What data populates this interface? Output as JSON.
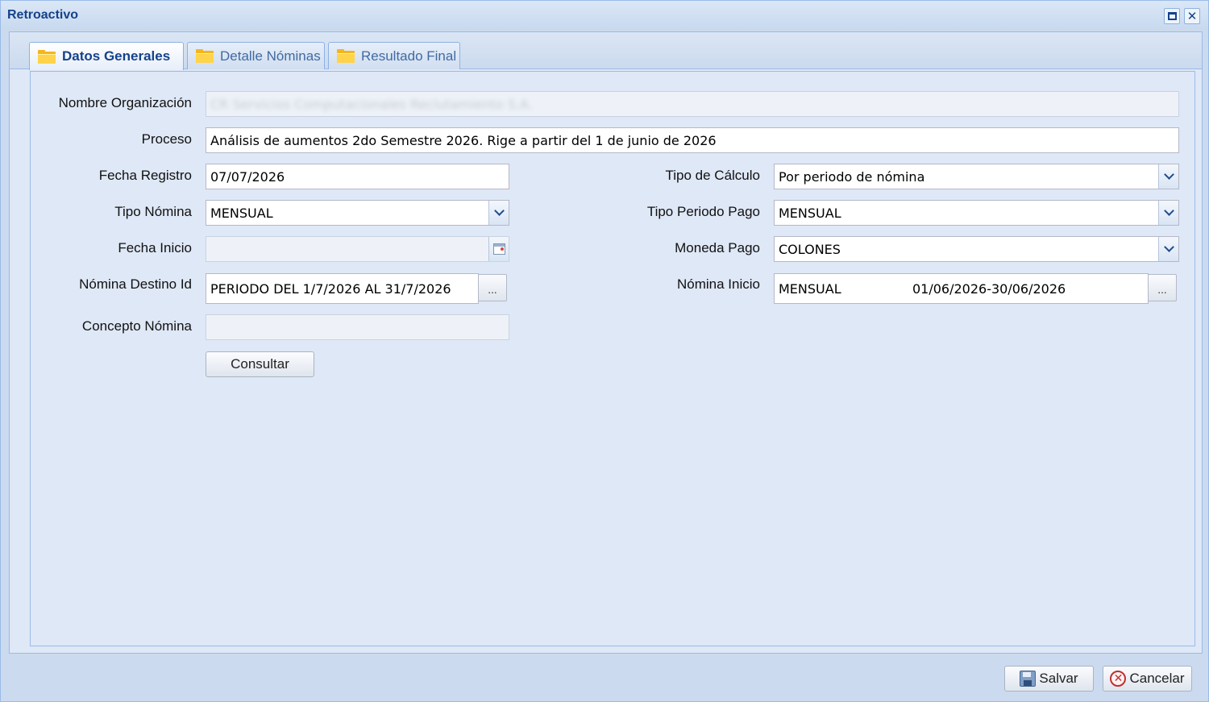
{
  "window": {
    "title": "Retroactivo"
  },
  "tabs": [
    {
      "label": "Datos Generales",
      "active": true
    },
    {
      "label": "Detalle Nóminas",
      "active": false
    },
    {
      "label": "Resultado Final",
      "active": false
    }
  ],
  "form": {
    "organizacion": {
      "label": "Nombre Organización",
      "value": "CR Servicios Computacionales Reclutamiento S.A."
    },
    "proceso": {
      "label": "Proceso",
      "value": "Análisis de aumentos 2do Semestre 2026. Rige a partir del 1 de junio de 2026"
    },
    "fecha_registro": {
      "label": "Fecha Registro",
      "value": "07/07/2026"
    },
    "tipo_nomina": {
      "label": "Tipo Nómina",
      "value": "MENSUAL"
    },
    "fecha_inicio": {
      "label": "Fecha Inicio",
      "value": ""
    },
    "nomina_destino": {
      "label": "Nómina Destino Id",
      "value": "PERIODO DEL 1/7/2026 AL 31/7/2026",
      "button": "..."
    },
    "concepto_nomina": {
      "label": "Concepto Nómina",
      "value": ""
    },
    "tipo_calculo": {
      "label": "Tipo de Cálculo",
      "value": "Por periodo de nómina"
    },
    "tipo_periodo_pago": {
      "label": "Tipo Periodo Pago",
      "value": "MENSUAL"
    },
    "moneda_pago": {
      "label": "Moneda Pago",
      "value": "COLONES"
    },
    "nomina_inicio": {
      "label": "Nómina Inicio",
      "value_type": "MENSUAL",
      "value_period": "01/06/2026-30/06/2026",
      "button": "..."
    },
    "consultar_label": "Consultar"
  },
  "footer": {
    "save_label": "Salvar",
    "cancel_label": "Cancelar"
  },
  "icons": {
    "tab": "folder-icon",
    "maximize": "maximize-icon",
    "close": "close-icon",
    "save": "save-icon",
    "cancel": "cancel-icon",
    "dropdown": "chevron-down-icon",
    "date": "calendar-icon"
  },
  "colors": {
    "title": "#15428b",
    "panel_bg": "#dfe8f6",
    "border": "#99bbe8"
  }
}
